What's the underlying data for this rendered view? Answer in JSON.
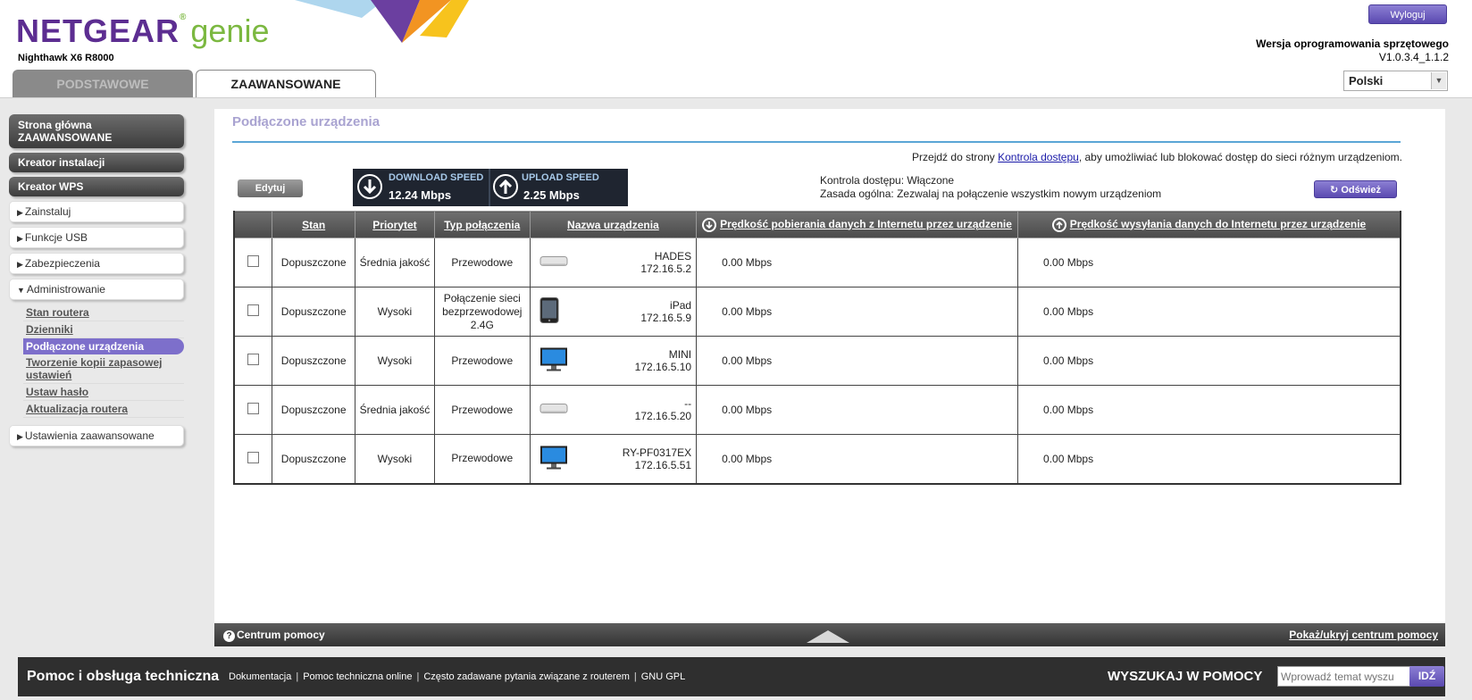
{
  "header": {
    "logo_brand": "NETGEAR",
    "logo_product": "genie",
    "logo_reg": "®",
    "model": "Nighthawk X6 R8000",
    "logout_label": "Wyloguj",
    "firmware_label": "Wersja oprogramowania sprzętowego",
    "firmware_version": "V1.0.3.4_1.1.2",
    "language_selected": "Polski",
    "tabs": [
      {
        "label": "PODSTAWOWE",
        "active": false
      },
      {
        "label": "ZAAWANSOWANE",
        "active": true
      }
    ]
  },
  "sidebar": {
    "main_items": [
      {
        "label": "Strona główna ZAAWANSOWANE"
      },
      {
        "label": "Kreator instalacji"
      },
      {
        "label": "Kreator WPS"
      }
    ],
    "sections": [
      {
        "label": "Zainstaluj",
        "expanded": false
      },
      {
        "label": "Funkcje USB",
        "expanded": false
      },
      {
        "label": "Zabezpieczenia",
        "expanded": false
      },
      {
        "label": "Administrowanie",
        "expanded": true
      }
    ],
    "admin_links": [
      {
        "label": "Stan routera",
        "active": false
      },
      {
        "label": "Dzienniki",
        "active": false
      },
      {
        "label": "Podłączone urządzenia",
        "active": true
      },
      {
        "label": "Tworzenie kopii zapasowej ustawień",
        "active": false
      },
      {
        "label": "Ustaw hasło",
        "active": false
      },
      {
        "label": "Aktualizacja routera",
        "active": false
      }
    ],
    "advanced_settings": "Ustawienia zaawansowane"
  },
  "main": {
    "title": "Podłączone urządzenia",
    "access_note_prefix": "Przejdź do strony ",
    "access_note_link": "Kontrola dostępu",
    "access_note_suffix": ", aby umożliwiać lub blokować dostęp do sieci różnym urządzeniom.",
    "edit_label": "Edytuj",
    "download_label": "DOWNLOAD SPEED",
    "download_value": "12.24 Mbps",
    "upload_label": "UPLOAD SPEED",
    "upload_value": "2.25 Mbps",
    "access_control_status": "Kontrola dostępu: Włączone",
    "general_rule": "Zasada ogólna: Zezwalaj na połączenie wszystkim nowym urządzeniom",
    "refresh_label": "Odśwież",
    "table": {
      "headers": {
        "status": "Stan",
        "priority": "Priorytet",
        "conn_type": "Typ połączenia",
        "device_name": "Nazwa urządzenia",
        "download": "Prędkość pobierania danych z Internetu przez urządzenie",
        "upload": "Prędkość wysyłania danych do Internetu przez urządzenie"
      },
      "rows": [
        {
          "status": "Dopuszczone",
          "priority": "Średnia jakość",
          "conn_type": "Przewodowe",
          "name": "HADES",
          "ip": "172.16.5.2",
          "icon": "mac-mini-icon",
          "down": "0.00 Mbps",
          "up": "0.00 Mbps"
        },
        {
          "status": "Dopuszczone",
          "priority": "Wysoki",
          "conn_type": "Połączenie sieci bezprzewodowej 2.4G",
          "name": "iPad",
          "ip": "172.16.5.9",
          "icon": "tablet-icon",
          "down": "0.00 Mbps",
          "up": "0.00 Mbps"
        },
        {
          "status": "Dopuszczone",
          "priority": "Wysoki",
          "conn_type": "Przewodowe",
          "name": "MINI",
          "ip": "172.16.5.10",
          "icon": "monitor-icon",
          "down": "0.00 Mbps",
          "up": "0.00 Mbps"
        },
        {
          "status": "Dopuszczone",
          "priority": "Średnia jakość",
          "conn_type": "Przewodowe",
          "name": "--",
          "ip": "172.16.5.20",
          "icon": "mac-mini-icon",
          "down": "0.00 Mbps",
          "up": "0.00 Mbps"
        },
        {
          "status": "Dopuszczone",
          "priority": "Wysoki",
          "conn_type": "Przewodowe",
          "name": "RY-PF0317EX",
          "ip": "172.16.5.51",
          "icon": "monitor-icon",
          "down": "0.00 Mbps",
          "up": "0.00 Mbps"
        }
      ]
    }
  },
  "help_bar": {
    "center_label": "Centrum pomocy",
    "toggle_label": "Pokaż/ukryj centrum pomocy"
  },
  "footer": {
    "title": "Pomoc i obsługa techniczna",
    "links": [
      "Dokumentacja",
      "Pomoc techniczna online",
      "Często zadawane pytania związane z routerem",
      "GNU GPL"
    ],
    "search_label": "WYSZUKAJ W POMOCY",
    "search_placeholder": "Wprowadź temat wyszu",
    "search_go": "IDŹ"
  },
  "colors": {
    "brand_purple": "#5c2d91",
    "brand_green": "#7bb840",
    "accent_button": "#6b5cc0",
    "title_rule": "#5aa6d6"
  }
}
